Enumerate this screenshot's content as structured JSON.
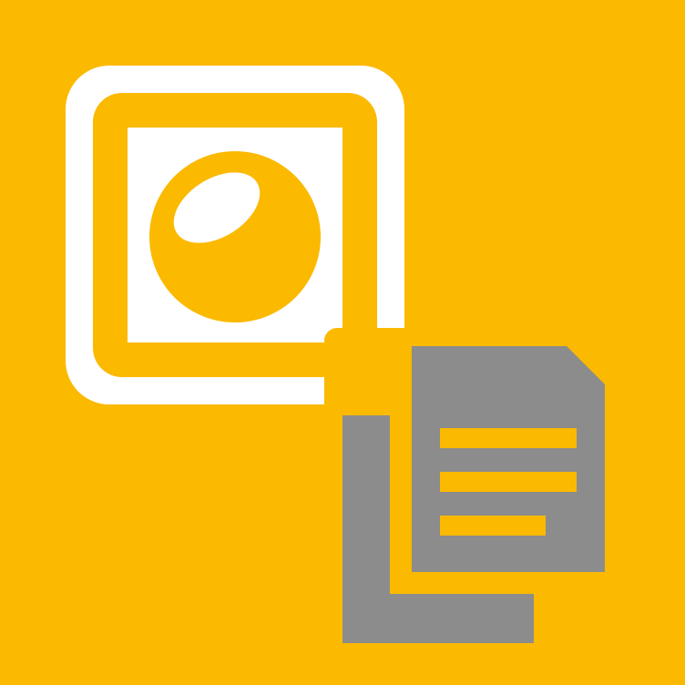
{
  "icon": {
    "name": "capture-and-copy-app-icon",
    "camera_glyph": "camera-lens-icon",
    "documents_glyph": "copy-documents-icon"
  },
  "colors": {
    "background": "#FBB900",
    "accent_light": "#FFFFFF",
    "document_gray": "#8C8C8C"
  }
}
